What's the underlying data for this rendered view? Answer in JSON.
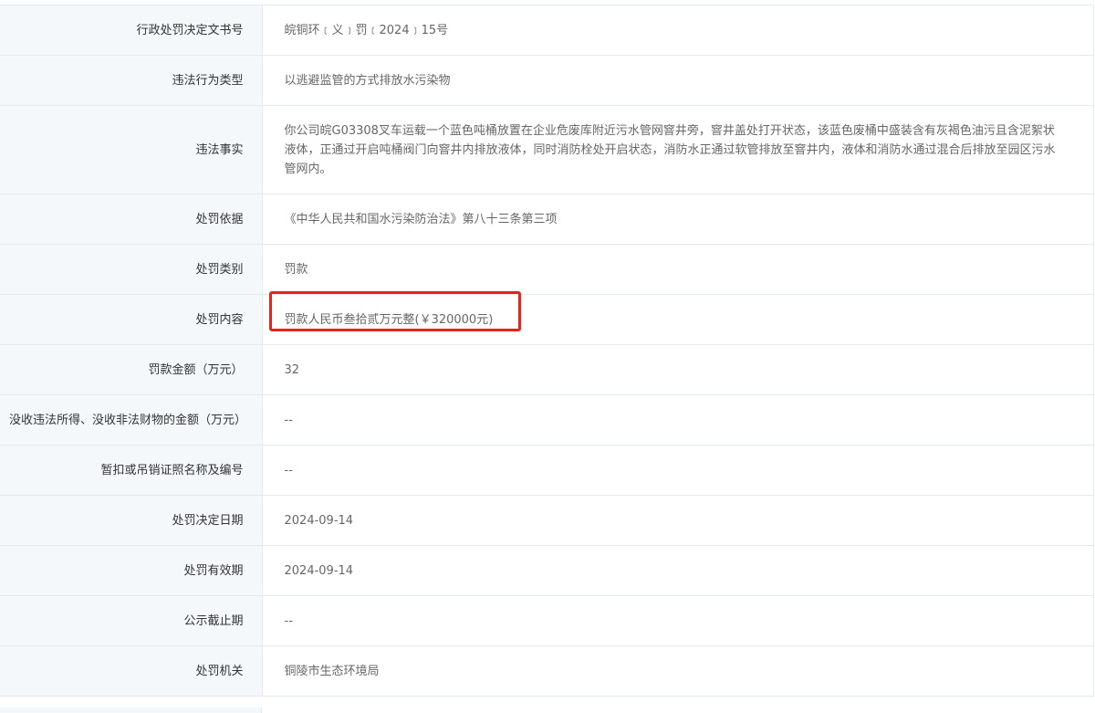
{
  "rows": [
    {
      "label": "行政处罚决定文书号",
      "value": "皖铜环﹝义﹞罚﹝2024﹞15号"
    },
    {
      "label": "违法行为类型",
      "value": "以逃避监管的方式排放水污染物"
    },
    {
      "label": "违法事实",
      "value": "你公司皖G03308叉车运载一个蓝色吨桶放置在企业危废库附近污水管网窨井旁，窨井盖处打开状态，该蓝色废桶中盛装含有灰褐色油污且含泥絮状液体，正通过开启吨桶阀门向窨井内排放液体，同时消防栓处开启状态，消防水正通过软管排放至窨井内，液体和消防水通过混合后排放至园区污水管网内。"
    },
    {
      "label": "处罚依据",
      "value": "《中华人民共和国水污染防治法》第八十三条第三项"
    },
    {
      "label": "处罚类别",
      "value": "罚款"
    },
    {
      "label": "处罚内容",
      "value": "罚款人民币叁拾贰万元整(￥320000元)"
    },
    {
      "label": "罚款金额（万元）",
      "value": "32"
    },
    {
      "label": "没收违法所得、没收非法财物的金额（万元）",
      "value": "--"
    },
    {
      "label": "暂扣或吊销证照名称及编号",
      "value": "--"
    },
    {
      "label": "处罚决定日期",
      "value": "2024-09-14"
    },
    {
      "label": "处罚有效期",
      "value": "2024-09-14"
    },
    {
      "label": "公示截止期",
      "value": "--"
    },
    {
      "label": "处罚机关",
      "value": "铜陵市生态环境局"
    }
  ],
  "colors": {
    "label_bg": "#f4f8fb",
    "border": "#e4e9ee",
    "highlight": "#e8231a"
  }
}
